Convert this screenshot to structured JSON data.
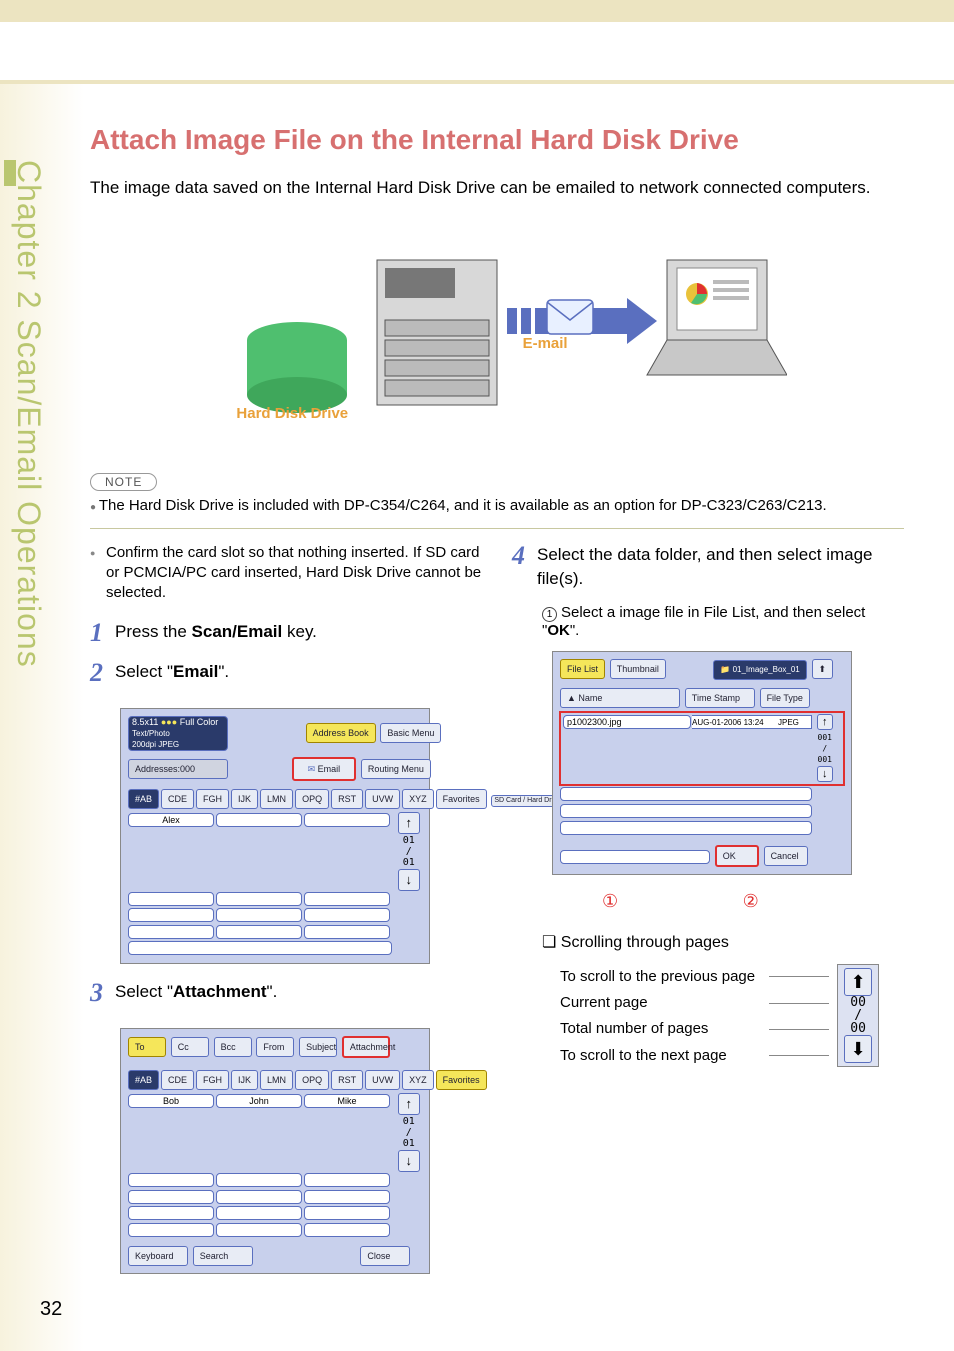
{
  "sideTab": "Chapter 2    Scan/Email Operations",
  "title": "Attach Image File on the Internal Hard Disk Drive",
  "intro": "The image data saved on the Internal Hard Disk Drive can be emailed to network connected computers.",
  "diagramLabels": {
    "hdd": "Hard Disk Drive",
    "email": "E-mail"
  },
  "notePill": "NOTE",
  "noteLine": "The Hard Disk Drive is included with DP-C354/C264, and it is available as an option for DP-C323/C263/C213.",
  "leftCol": {
    "bullet": "Confirm the card slot so that nothing inserted. If SD card or PCMCIA/PC card inserted, Hard Disk Drive cannot be selected.",
    "step1": {
      "pre": "Press the ",
      "bold": "Scan/Email",
      "post": " key."
    },
    "step2": {
      "pre": "Select \"",
      "bold": "Email",
      "post": "\"."
    },
    "step3": {
      "pre": "Select \"",
      "bold": "Attachment",
      "post": "\"."
    }
  },
  "rightCol": {
    "step4": "Select the data folder, and then select image file(s).",
    "sub1": {
      "pre": "Select a image file in File List, and then select \"",
      "bold": "OK",
      "post": "\"."
    },
    "scrollHeading": "Scrolling through pages",
    "scrollLabels": {
      "prev": "To scroll to the previous page",
      "current": "Current page",
      "total": "Total number of pages",
      "next": "To scroll to the next page"
    },
    "scrollPager": {
      "cur": "00",
      "sep": "/",
      "tot": "00"
    }
  },
  "screen2": {
    "topInfo": [
      "8.5x11",
      "Full Color",
      "Text/Photo",
      "200dpi JPEG"
    ],
    "addresses": "Addresses:000",
    "addressBook": "Address Book",
    "basicMenu": "Basic Menu",
    "email": "Email",
    "routingMenu": "Routing Menu",
    "tabs": [
      "#AB",
      "CDE",
      "FGH",
      "IJK",
      "LMN",
      "OPQ",
      "RST",
      "UVW",
      "XYZ",
      "Favorites"
    ],
    "sdCard": "SD Card / Hard Drive",
    "names": [
      "Alex"
    ],
    "pager": {
      "cur": "01",
      "sep": "/",
      "tot": "01"
    }
  },
  "screen3": {
    "topTabs": [
      "To",
      "Cc",
      "Bcc",
      "From",
      "Subject",
      "Attachment"
    ],
    "tabs": [
      "#AB",
      "CDE",
      "FGH",
      "IJK",
      "LMN",
      "OPQ",
      "RST",
      "UVW",
      "XYZ",
      "Favorites"
    ],
    "names": [
      "Bob",
      "John",
      "Mike"
    ],
    "bottomBtns": [
      "Keyboard",
      "Search",
      "Close"
    ],
    "pager": {
      "cur": "01",
      "sep": "/",
      "tot": "01"
    }
  },
  "screen4": {
    "fileList": "File List",
    "thumbnail": "Thumbnail",
    "boxLabel": "01_Image_Box_01",
    "headers": [
      "Name",
      "Time Stamp",
      "File Type"
    ],
    "row": {
      "name": "p1002300.jpg",
      "ts": "AUG-01-2006 13:24",
      "type": "JPEG"
    },
    "ok": "OK",
    "cancel": "Cancel",
    "pager": {
      "cur": "001",
      "sep": "/",
      "tot": "001"
    }
  },
  "pageNumber": "32"
}
